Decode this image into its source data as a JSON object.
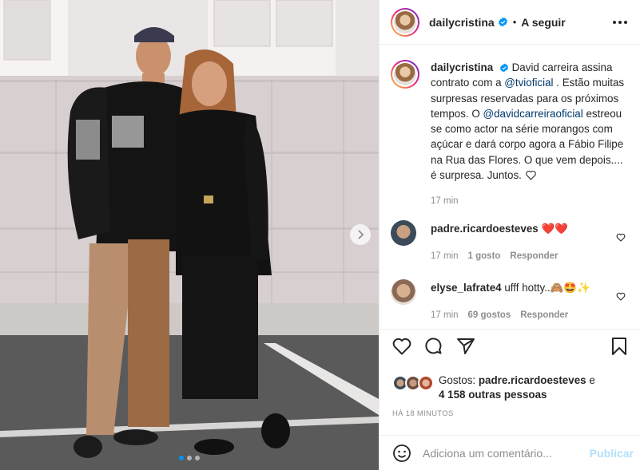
{
  "post": {
    "username": "dailycristina",
    "separator": "•",
    "follow_label": "A seguir",
    "caption": {
      "username": "dailycristina",
      "part1": "David carreira assina contrato com a ",
      "mention1": "@tvioficial",
      "part2": " . Estão muitas surpresas reservadas para os próximos tempos. O ",
      "mention2": "@davidcarreiraoficial",
      "part3": " estreou se como actor na série morangos com açúcar e dará corpo agora a Fábio Filipe na Rua das Flores. O que vem depois.... é surpresa. Juntos. ",
      "time": "17 min"
    },
    "carousel": {
      "total_slides": 3,
      "active_slide": 1
    }
  },
  "comments": [
    {
      "username": "padre.ricardoesteves",
      "text": "❤️❤️",
      "time": "17 min",
      "likes": "1 gosto",
      "reply": "Responder"
    },
    {
      "username": "elyse_lafrate4",
      "text": "ufff hotty..🙈🤩✨",
      "time": "17 min",
      "likes": "69 gostos",
      "reply": "Responder"
    }
  ],
  "likes": {
    "prefix": "Gostos: ",
    "user": "padre.ricardoesteves",
    "mid": " e",
    "others": "4 158 outras pessoas"
  },
  "timestamp": "HÁ 18 MINUTOS",
  "comment_box": {
    "placeholder": "Adiciona um comentário...",
    "publish_label": "Publicar"
  },
  "colors": {
    "verified": "#0095f6",
    "mention": "#00376b",
    "like_red": "#ed4956",
    "publish_disabled": "#b2dffc"
  }
}
